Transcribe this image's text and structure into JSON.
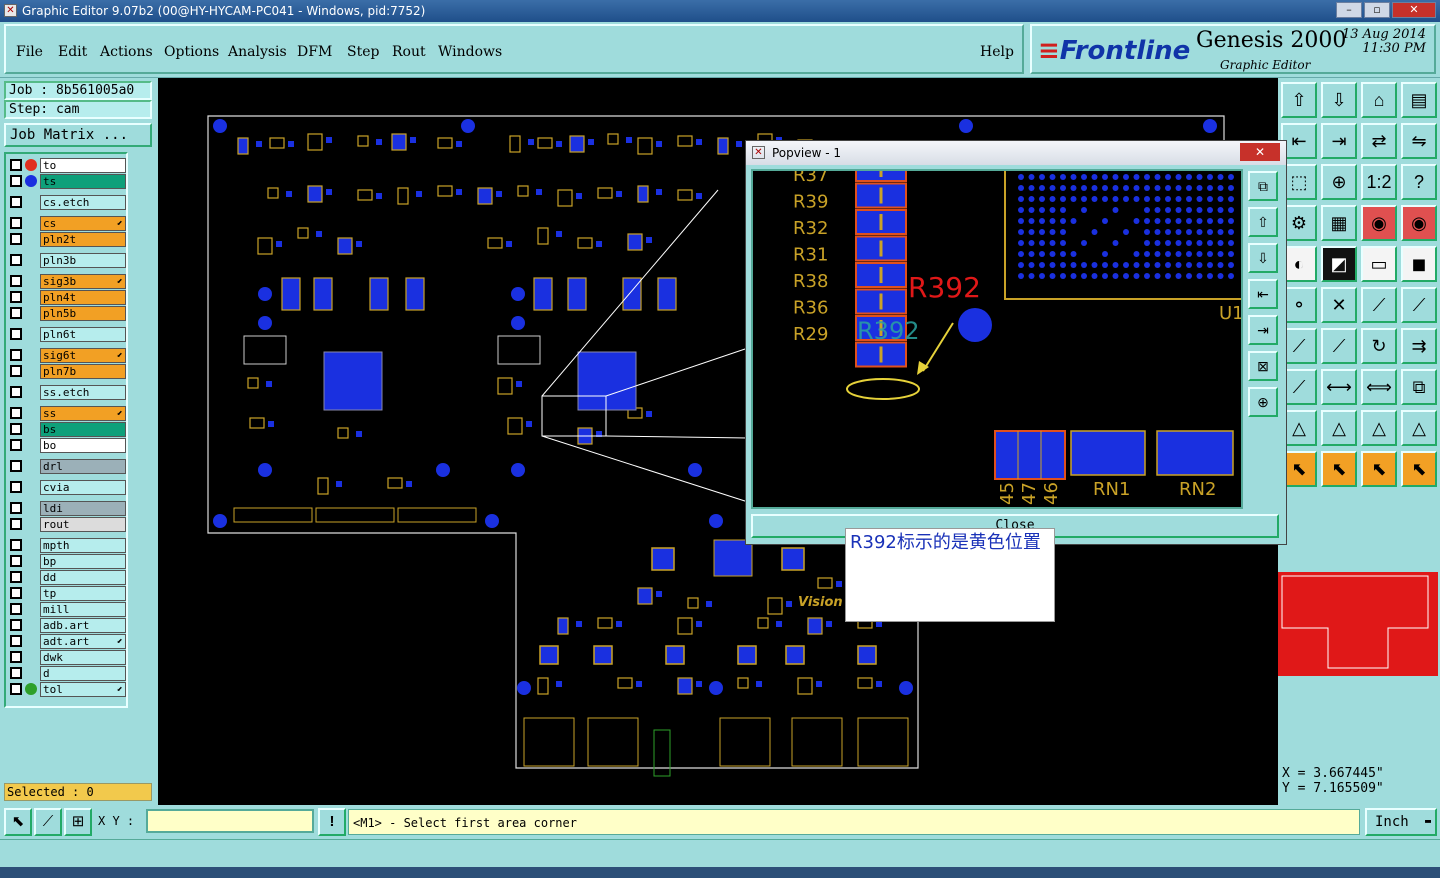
{
  "window": {
    "title": "Graphic Editor 9.07b2 (00@HY-HYCAM-PC041 - Windows, pid:7752)"
  },
  "menu": {
    "items": [
      "File",
      "Edit",
      "Actions",
      "Options",
      "Analysis",
      "DFM",
      "Step",
      "Rout",
      "Windows"
    ],
    "help": "Help"
  },
  "brand": {
    "logo": "Frontline",
    "product": "Genesis 2000",
    "subtitle": "Graphic Editor",
    "date": "13 Aug 2014",
    "time": "11:30 PM"
  },
  "job": {
    "job_label": "Job : 8b561005a0",
    "step_label": "Step: cam",
    "matrix_button": "Job Matrix ..."
  },
  "layers": [
    {
      "name": "to",
      "color": "#ffffff",
      "dot": "#e03020",
      "arrow": ""
    },
    {
      "name": "ts",
      "color": "#0ea07a",
      "dot": "#1a30e0",
      "arrow": ""
    },
    {
      "name": "cs.etch",
      "color": "#b6eded",
      "dot": "",
      "arrow": ""
    },
    {
      "name": "cs",
      "color": "#f2a024",
      "dot": "",
      "arrow": "⬋"
    },
    {
      "name": "pln2t",
      "color": "#f2a024",
      "dot": "",
      "arrow": ""
    },
    {
      "name": "pln3b",
      "color": "#b6eded",
      "dot": "",
      "arrow": ""
    },
    {
      "name": "sig3b",
      "color": "#f2a024",
      "dot": "",
      "arrow": "⬋"
    },
    {
      "name": "pln4t",
      "color": "#f2a024",
      "dot": "",
      "arrow": ""
    },
    {
      "name": "pln5b",
      "color": "#f2a024",
      "dot": "",
      "arrow": ""
    },
    {
      "name": "pln6t",
      "color": "#b6eded",
      "dot": "",
      "arrow": ""
    },
    {
      "name": "sig6t",
      "color": "#f2a024",
      "dot": "",
      "arrow": "⬋"
    },
    {
      "name": "pln7b",
      "color": "#f2a024",
      "dot": "",
      "arrow": ""
    },
    {
      "name": "ss.etch",
      "color": "#b6eded",
      "dot": "",
      "arrow": ""
    },
    {
      "name": "ss",
      "color": "#f2a024",
      "dot": "",
      "arrow": "⬋"
    },
    {
      "name": "bs",
      "color": "#0ea07a",
      "dot": "",
      "arrow": ""
    },
    {
      "name": "bo",
      "color": "#ffffff",
      "dot": "",
      "arrow": ""
    },
    {
      "name": "drl",
      "color": "#9bb0b8",
      "dot": "",
      "arrow": ""
    },
    {
      "name": "cvia",
      "color": "#b6eded",
      "dot": "",
      "arrow": ""
    },
    {
      "name": "ldi",
      "color": "#9bb0b8",
      "dot": "",
      "arrow": ""
    },
    {
      "name": "rout",
      "color": "#dcdcdc",
      "dot": "",
      "arrow": ""
    },
    {
      "name": "mpth",
      "color": "#b6eded",
      "dot": "",
      "arrow": ""
    },
    {
      "name": "bp",
      "color": "#b6eded",
      "dot": "",
      "arrow": ""
    },
    {
      "name": "dd",
      "color": "#b6eded",
      "dot": "",
      "arrow": ""
    },
    {
      "name": "tp",
      "color": "#b6eded",
      "dot": "",
      "arrow": ""
    },
    {
      "name": "mill",
      "color": "#b6eded",
      "dot": "",
      "arrow": ""
    },
    {
      "name": "adb.art",
      "color": "#b6eded",
      "dot": "",
      "arrow": ""
    },
    {
      "name": "adt.art",
      "color": "#b6eded",
      "dot": "",
      "arrow": "⬋"
    },
    {
      "name": "dwk",
      "color": "#b6eded",
      "dot": "",
      "arrow": ""
    },
    {
      "name": "d",
      "color": "#b6eded",
      "dot": "",
      "arrow": ""
    },
    {
      "name": "tol",
      "color": "#b6eded",
      "dot": "#2ea02a",
      "arrow": "⬋"
    }
  ],
  "selected": "Selected : 0",
  "popup": {
    "title": "Popview - 1",
    "close_button": "Close",
    "resistor_labels": [
      "R37",
      "R39",
      "R32",
      "R31",
      "R38",
      "R36",
      "R29"
    ],
    "highlight_label": "R392",
    "ghost_label": "R392",
    "bottom_labels": [
      "45",
      "47",
      "46",
      "RN1",
      "RN2"
    ],
    "u_label": "U1"
  },
  "note": "R392标示的是黄色位置",
  "coords": {
    "x": "X = 3.667445\"",
    "y": "Y = 7.165509\""
  },
  "bottom": {
    "xy_label": "X Y :",
    "xy_value": "",
    "message": "<M1> - Select first area corner",
    "units": "Inch"
  }
}
